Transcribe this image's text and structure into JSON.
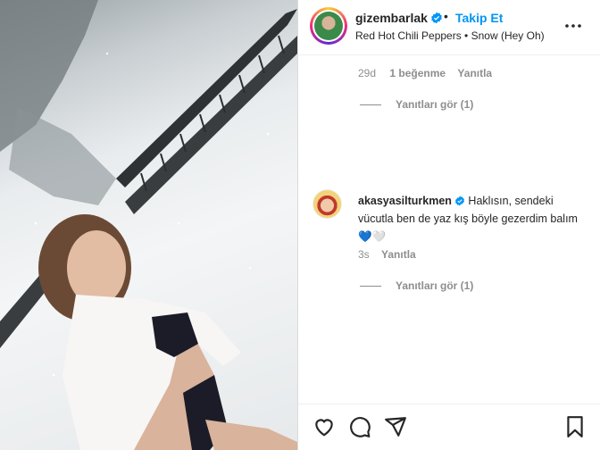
{
  "post": {
    "author": "gizembarlak",
    "separator": "•",
    "follow_label": "Takip Et",
    "audio": "Red Hot Chili Peppers • Snow (Hey Oh)"
  },
  "first_comment": {
    "age": "29d",
    "likes": "1 beğenme",
    "reply_label": "Yanıtla",
    "view_replies": "Yanıtları gör (1)"
  },
  "second_comment": {
    "author": "akasyasilturkmen",
    "text": " Haklısın, sendeki vücutla ben de yaz kış böyle gezerdim balım 💙🤍",
    "age": "3s",
    "reply_label": "Yanıtla",
    "view_replies": "Yanıtları gör (1)"
  },
  "icons": {
    "verified": "verified-badge-icon",
    "more": "more-options-icon",
    "like": "heart-icon",
    "comment": "comment-icon",
    "share": "share-icon",
    "save": "bookmark-icon"
  },
  "colors": {
    "accent": "#0095f6",
    "muted": "#8e8e8e",
    "text": "#262626"
  }
}
